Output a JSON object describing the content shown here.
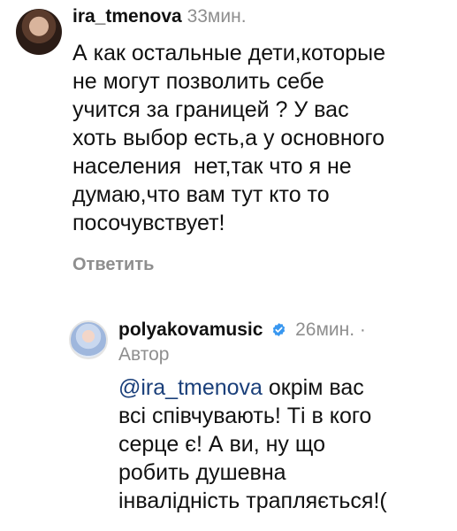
{
  "comments": [
    {
      "username": "ira_tmenova",
      "time": "33мин.",
      "text": "А как остальные дети,которые\nне могут позволить себе\nучится за границей ? У вас\nхоть выбор есть,а у основного\nнаселения  нет,так что я не\nдумаю,что вам тут кто то\nпосочувствует!",
      "reply_label": "Ответить"
    },
    {
      "username": "polyakovamusic",
      "verified": true,
      "time": "26мин.",
      "separator": "·",
      "author_label": "Автор",
      "mention": "@ira_tmenova",
      "text": " окрім вас\nвсі співчувають! Ті в кого\nсерце є! А ви, ну що\nробить душевна\nінвалідність трапляється!("
    }
  ],
  "icons": {
    "verified_badge": "verified-badge-icon",
    "verified_color": "#3897f0"
  },
  "colors": {
    "primary_text": "#111111",
    "secondary_text": "#8e8e8e",
    "mention": "#1a3f7a"
  }
}
